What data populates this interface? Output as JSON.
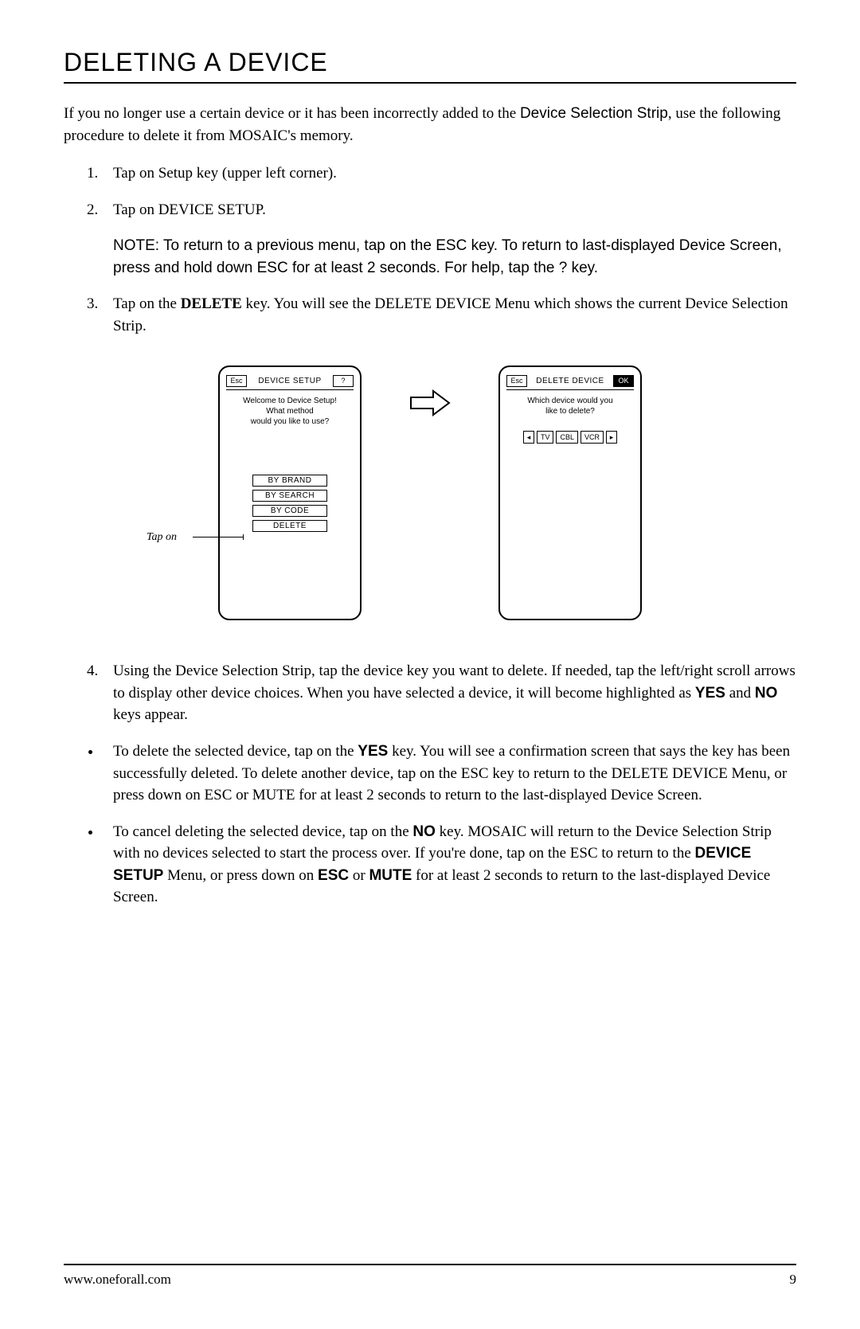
{
  "title": "DELETING A DEVICE",
  "intro_part1": "If you no longer use a certain device or it has been incorrectly added to the ",
  "intro_strip": "Device Selection Strip",
  "intro_part2": ", use the following procedure to delete it from MOSAIC's memory.",
  "step1": "Tap on Setup key (upper left corner).",
  "step2": "Tap on DEVICE SETUP.",
  "note_prefix": "NOTE: ",
  "note_part1": "To return to a previous menu, tap on the ",
  "note_esc": "ESC",
  "note_part2": " key. To return to last-displayed Device Screen, press and hold down ESC for at least 2 seconds. For help, tap the ? key.",
  "step3_a": "Tap on the ",
  "step3_delete": "DELETE",
  "step3_b": " key. You will see the DELETE DEVICE Menu which shows the current Device Selection Strip.",
  "tap_on_label": "Tap on",
  "screen1": {
    "esc": "Esc",
    "title": "DEVICE SETUP",
    "help": "?",
    "msg1": "Welcome to Device Setup!",
    "msg2": "What method",
    "msg3": "would you like to use?",
    "items": [
      "BY BRAND",
      "BY SEARCH",
      "BY CODE",
      "DELETE"
    ]
  },
  "screen2": {
    "esc": "Esc",
    "title": "DELETE DEVICE",
    "ok": "OK",
    "msg1": "Which device would you",
    "msg2": "like to delete?",
    "left": "◂",
    "right": "▸",
    "devices": [
      "TV",
      "CBL",
      "VCR"
    ]
  },
  "step4_a": "Using the Device Selection Strip, tap the device key you want to delete. If needed, tap the left/right scroll arrows to display other device choices. When you have selected a device, it will become highlighted as ",
  "step4_yes": "YES",
  "step4_and": " and ",
  "step4_no": "NO",
  "step4_b": " keys appear.",
  "bullet1_a": "To delete the selected device, tap on the ",
  "bullet1_yes": "YES",
  "bullet1_b": " key. You will see a confirmation screen that says the key has been successfully deleted. To delete another device, tap on the ESC key to return to the DELETE DEVICE Menu, or press down on ESC or MUTE for at least 2 seconds to return to the last-displayed Device Screen.",
  "bullet2_a": "To cancel deleting the selected device, tap on the ",
  "bullet2_no": "NO",
  "bullet2_b": " key. MOSAIC will return to the Device Selection Strip with no devices selected to start the process over. If you're done, tap on the ESC to return to the ",
  "bullet2_device_setup": "DEVICE SETUP",
  "bullet2_c": " Menu, or press down on ",
  "bullet2_esc": "ESC",
  "bullet2_or": " or ",
  "bullet2_mute": "MUTE",
  "bullet2_d": " for at least 2 seconds to return to the last-displayed Device Screen.",
  "footer_url": "www.oneforall.com",
  "footer_page": "9"
}
